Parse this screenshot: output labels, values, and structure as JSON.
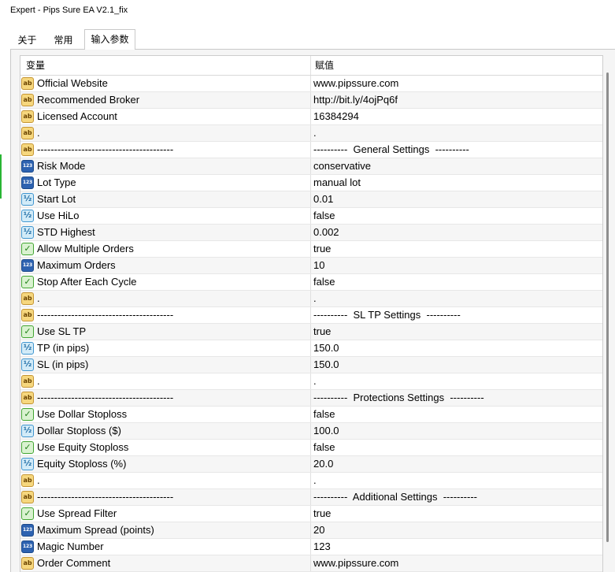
{
  "window": {
    "title": "Expert - Pips Sure EA V2.1_fix"
  },
  "tabs": [
    {
      "label": "关于",
      "active": false
    },
    {
      "label": "常用",
      "active": false
    },
    {
      "label": "输入参数",
      "active": true
    }
  ],
  "inputs_table": {
    "columns": {
      "variable": "变量",
      "value": "赋值"
    },
    "rows": [
      {
        "icon": "string-type-icon",
        "name": "Official Website",
        "value": "www.pipssure.com"
      },
      {
        "icon": "string-type-icon",
        "name": "Recommended Broker",
        "value": "http://bit.ly/4ojPq6f"
      },
      {
        "icon": "string-type-icon",
        "name": "Licensed Account",
        "value": "16384294"
      },
      {
        "icon": "string-type-icon",
        "name": ".",
        "value": "."
      },
      {
        "icon": "string-type-icon",
        "name": "----------------------------------------",
        "value": "----------  General Settings  ----------"
      },
      {
        "icon": "integer-type-icon",
        "name": "Risk Mode",
        "value": "conservative"
      },
      {
        "icon": "integer-type-icon",
        "name": "Lot Type",
        "value": "manual lot"
      },
      {
        "icon": "double-type-icon",
        "name": "Start Lot",
        "value": "0.01"
      },
      {
        "icon": "double-type-icon",
        "name": "Use HiLo",
        "value": "false"
      },
      {
        "icon": "double-type-icon",
        "name": "STD Highest",
        "value": "0.002"
      },
      {
        "icon": "bool-type-icon",
        "name": "Allow Multiple Orders",
        "value": "true"
      },
      {
        "icon": "integer-type-icon",
        "name": "Maximum Orders",
        "value": "10"
      },
      {
        "icon": "bool-type-icon",
        "name": "Stop After Each Cycle",
        "value": "false"
      },
      {
        "icon": "string-type-icon",
        "name": ".",
        "value": "."
      },
      {
        "icon": "string-type-icon",
        "name": "----------------------------------------",
        "value": "----------  SL TP Settings  ----------"
      },
      {
        "icon": "bool-type-icon",
        "name": "Use SL TP",
        "value": "true"
      },
      {
        "icon": "double-type-icon",
        "name": "TP (in pips)",
        "value": "150.0"
      },
      {
        "icon": "double-type-icon",
        "name": "SL (in pips)",
        "value": "150.0"
      },
      {
        "icon": "string-type-icon",
        "name": ".",
        "value": "."
      },
      {
        "icon": "string-type-icon",
        "name": "----------------------------------------",
        "value": "----------  Protections Settings  ----------"
      },
      {
        "icon": "bool-type-icon",
        "name": "Use Dollar Stoploss",
        "value": "false"
      },
      {
        "icon": "double-type-icon",
        "name": "Dollar Stoploss ($)",
        "value": "100.0"
      },
      {
        "icon": "bool-type-icon",
        "name": "Use Equity Stoploss",
        "value": "false"
      },
      {
        "icon": "double-type-icon",
        "name": "Equity Stoploss (%)",
        "value": "20.0"
      },
      {
        "icon": "string-type-icon",
        "name": ".",
        "value": "."
      },
      {
        "icon": "string-type-icon",
        "name": "----------------------------------------",
        "value": "----------  Additional Settings  ----------"
      },
      {
        "icon": "bool-type-icon",
        "name": "Use Spread Filter",
        "value": "true"
      },
      {
        "icon": "integer-type-icon",
        "name": "Maximum Spread (points)",
        "value": "20"
      },
      {
        "icon": "integer-type-icon",
        "name": "Magic Number",
        "value": "123"
      },
      {
        "icon": "string-type-icon",
        "name": "Order Comment",
        "value": "www.pipssure.com"
      }
    ]
  },
  "colors": {
    "string_icon": "#f6d77e",
    "integer_icon": "#2d62b0",
    "double_icon": "#d2ebf8",
    "bool_icon": "#d9f2d0",
    "row_alt": "#f6f6f6"
  }
}
